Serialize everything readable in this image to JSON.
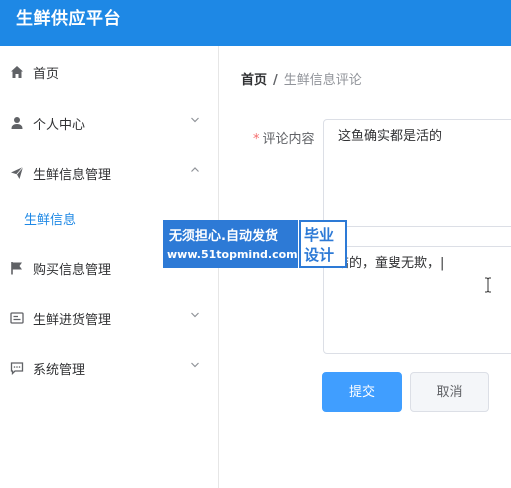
{
  "header": {
    "title": "生鲜供应平台"
  },
  "sidebar": {
    "items": [
      {
        "label": "首页",
        "icon": "home-icon"
      },
      {
        "label": "个人中心",
        "icon": "user-icon",
        "chevron": "chevron-down-icon"
      },
      {
        "label": "生鲜信息管理",
        "icon": "send-icon",
        "chevron": "chevron-up-icon"
      },
      {
        "label": "生鲜信息",
        "sub": true
      },
      {
        "label": "购买信息管理",
        "icon": "flag-icon"
      },
      {
        "label": "生鲜进货管理",
        "icon": "card-icon",
        "chevron": "chevron-down-icon"
      },
      {
        "label": "系统管理",
        "icon": "chat-icon",
        "chevron": "chevron-down-icon"
      }
    ]
  },
  "breadcrumb": {
    "home": "首页",
    "separator": "/",
    "current": "生鲜信息评论"
  },
  "form": {
    "comment_label": "评论内容",
    "required_mark": "*",
    "comment_value": "这鱼确实都是活的",
    "reply_value": "结的，童叟无欺，|"
  },
  "buttons": {
    "submit": "提交",
    "cancel": "取消"
  },
  "watermark": {
    "line1": "无须担心.自动发货",
    "line2": "www.51topmind.com",
    "badge1": "毕业",
    "badge2": "设计"
  },
  "colors": {
    "primary": "#1e88e5",
    "button": "#409eff",
    "required": "#f56c6c"
  }
}
